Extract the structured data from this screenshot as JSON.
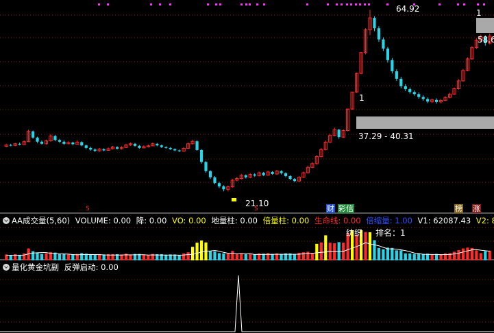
{
  "colors": {
    "background": "#000000",
    "grid": "#8b1a1a",
    "up": "#ff2a2a",
    "down": "#2ad4e8",
    "yellow": "#ffff00",
    "white": "#ffffff",
    "magenta": "#ff33ff",
    "gray_box": "#a9a9a9"
  },
  "price_panel": {
    "high_label": "64.92",
    "low_label": "21.10",
    "right_label": "58.6",
    "range_label": "37.29 - 40.31",
    "marker_1": "1",
    "marker_2": "1",
    "signal_tags": [
      {
        "text": "S"
      },
      {
        "text": "S"
      },
      {
        "text": "财"
      },
      {
        "text": "彩信"
      },
      {
        "text": "榜"
      },
      {
        "text": "涨"
      }
    ]
  },
  "volume_panel": {
    "indicator_name": "AA成交量(5,60)",
    "fields": [
      {
        "text": "VOLUME: 0.00",
        "color": "#ffffff"
      },
      {
        "text": "降: 0.00",
        "color": "#ffffff"
      },
      {
        "text": "VO: 0.00",
        "color": "#ffff00"
      },
      {
        "text": "地量柱: 0.00",
        "color": "#ffffff"
      },
      {
        "text": "倍量柱: 0.00",
        "color": "#ffff00"
      },
      {
        "text": "生命线: 0.00",
        "color": "#ff2a2a"
      },
      {
        "text": "倍缩量: 1.00",
        "color": "#2f4fff"
      },
      {
        "text": "V1: 62087.43",
        "color": "#ffffff"
      },
      {
        "text": "V2: 82337.84",
        "color": "#ffff00"
      }
    ],
    "note_1": "纺织",
    "note_2": "排名：1"
  },
  "indicator_panel": {
    "indicator_name": "量化黄金坑副",
    "fields": [
      {
        "text": "反弹启动: 0.00",
        "color": "#ffffff"
      }
    ]
  },
  "chart_data": {
    "type": "candlestick",
    "title": "",
    "price_high": 64.92,
    "price_low": 21.1,
    "candles": [
      [
        32.0,
        32.3,
        32.5,
        31.8
      ],
      [
        32.3,
        32.2,
        32.6,
        32.0
      ],
      [
        32.2,
        32.6,
        32.8,
        32.0
      ],
      [
        32.6,
        32.4,
        32.9,
        32.2
      ],
      [
        32.4,
        33.1,
        33.4,
        32.3
      ],
      [
        33.1,
        35.6,
        36.0,
        33.0
      ],
      [
        35.6,
        34.1,
        35.8,
        33.8
      ],
      [
        34.1,
        33.1,
        34.3,
        32.8
      ],
      [
        33.1,
        32.6,
        33.4,
        32.4
      ],
      [
        32.6,
        33.3,
        33.6,
        32.4
      ],
      [
        33.3,
        34.5,
        34.9,
        33.1
      ],
      [
        34.5,
        33.5,
        34.7,
        33.2
      ],
      [
        33.5,
        33.1,
        33.8,
        32.8
      ],
      [
        33.1,
        32.6,
        33.4,
        32.3
      ],
      [
        32.6,
        32.9,
        33.2,
        32.5
      ],
      [
        32.9,
        32.5,
        33.1,
        32.2
      ],
      [
        32.5,
        33.0,
        33.4,
        32.4
      ],
      [
        33.0,
        32.2,
        33.2,
        32.0
      ],
      [
        32.2,
        31.6,
        32.4,
        31.3
      ],
      [
        31.6,
        31.2,
        31.9,
        30.9
      ],
      [
        31.2,
        30.9,
        31.5,
        30.6
      ],
      [
        30.9,
        31.3,
        31.6,
        30.7
      ],
      [
        31.3,
        31.0,
        31.5,
        30.8
      ],
      [
        31.0,
        31.4,
        31.7,
        30.9
      ],
      [
        31.4,
        31.8,
        32.1,
        31.2
      ],
      [
        31.8,
        31.4,
        32.0,
        31.2
      ],
      [
        31.4,
        31.7,
        32.0,
        31.2
      ],
      [
        31.7,
        32.3,
        32.6,
        31.6
      ],
      [
        32.3,
        32.6,
        32.9,
        32.1
      ],
      [
        32.6,
        32.1,
        32.8,
        31.9
      ],
      [
        32.1,
        31.6,
        32.3,
        31.4
      ],
      [
        31.6,
        31.9,
        32.2,
        31.5
      ],
      [
        31.9,
        32.1,
        32.4,
        31.7
      ],
      [
        32.1,
        32.6,
        32.9,
        32.0
      ],
      [
        32.6,
        32.2,
        32.8,
        32.0
      ],
      [
        32.2,
        31.8,
        32.4,
        31.6
      ],
      [
        31.8,
        31.6,
        32.0,
        31.4
      ],
      [
        31.6,
        31.3,
        31.8,
        31.1
      ],
      [
        31.3,
        31.0,
        31.5,
        30.8
      ],
      [
        31.0,
        30.8,
        31.2,
        30.6
      ],
      [
        30.8,
        31.5,
        31.8,
        30.7
      ],
      [
        31.5,
        32.6,
        32.9,
        31.4
      ],
      [
        32.6,
        33.2,
        33.6,
        32.4
      ],
      [
        33.2,
        31.1,
        33.4,
        30.9
      ],
      [
        31.1,
        28.2,
        31.3,
        27.8
      ],
      [
        28.2,
        26.0,
        28.4,
        25.6
      ],
      [
        26.0,
        24.5,
        26.2,
        24.1
      ],
      [
        24.5,
        23.1,
        24.8,
        22.8
      ],
      [
        23.1,
        22.3,
        23.4,
        21.9
      ],
      [
        22.3,
        21.6,
        22.6,
        21.1
      ],
      [
        21.6,
        22.2,
        22.5,
        21.1
      ],
      [
        22.2,
        23.8,
        24.1,
        22.0
      ],
      [
        23.8,
        24.2,
        24.6,
        23.5
      ],
      [
        24.2,
        25.0,
        25.3,
        24.0
      ],
      [
        25.0,
        24.5,
        25.2,
        24.2
      ],
      [
        24.5,
        25.2,
        25.5,
        24.3
      ],
      [
        25.2,
        24.9,
        25.5,
        24.6
      ],
      [
        24.9,
        25.6,
        25.9,
        24.7
      ],
      [
        25.6,
        25.0,
        25.8,
        24.8
      ],
      [
        25.0,
        25.8,
        26.1,
        24.9
      ],
      [
        25.8,
        25.3,
        26.0,
        25.1
      ],
      [
        25.3,
        26.0,
        26.3,
        25.1
      ],
      [
        26.0,
        25.5,
        26.2,
        25.2
      ],
      [
        25.5,
        24.8,
        25.7,
        24.5
      ],
      [
        24.8,
        24.1,
        25.0,
        23.8
      ],
      [
        24.1,
        23.6,
        24.3,
        23.3
      ],
      [
        23.6,
        24.5,
        24.8,
        23.4
      ],
      [
        24.5,
        25.6,
        25.9,
        24.4
      ],
      [
        25.6,
        26.9,
        27.3,
        25.4
      ],
      [
        26.9,
        27.8,
        28.2,
        26.7
      ],
      [
        27.8,
        29.5,
        29.9,
        27.6
      ],
      [
        29.5,
        31.2,
        31.6,
        29.3
      ],
      [
        31.2,
        33.0,
        33.4,
        31.0
      ],
      [
        33.0,
        34.6,
        35.0,
        32.8
      ],
      [
        34.6,
        36.0,
        36.5,
        34.4
      ],
      [
        36.0,
        34.2,
        36.2,
        33.8
      ],
      [
        34.2,
        35.8,
        36.1,
        34.0
      ],
      [
        35.8,
        41.0,
        41.0,
        35.6
      ],
      [
        41.0,
        45.1,
        45.1,
        40.8
      ],
      [
        45.1,
        49.6,
        49.8,
        44.9
      ],
      [
        49.6,
        54.6,
        54.8,
        49.4
      ],
      [
        54.6,
        60.1,
        60.5,
        54.2
      ],
      [
        60.1,
        63.0,
        64.92,
        58.8
      ],
      [
        63.0,
        60.5,
        63.4,
        59.8
      ],
      [
        60.5,
        57.8,
        61.0,
        57.2
      ],
      [
        57.8,
        55.6,
        58.3,
        55.0
      ],
      [
        55.6,
        52.8,
        56.0,
        52.2
      ],
      [
        52.8,
        50.1,
        53.3,
        49.6
      ],
      [
        50.1,
        48.3,
        50.6,
        47.8
      ],
      [
        48.3,
        46.5,
        48.8,
        46.0
      ],
      [
        46.5,
        45.8,
        47.0,
        45.3
      ],
      [
        45.8,
        45.1,
        46.2,
        44.7
      ],
      [
        45.1,
        44.6,
        45.5,
        44.2
      ],
      [
        44.6,
        43.9,
        45.0,
        43.5
      ],
      [
        43.9,
        43.4,
        44.3,
        43.0
      ],
      [
        43.4,
        42.8,
        43.8,
        42.4
      ],
      [
        42.8,
        43.2,
        43.5,
        42.5
      ],
      [
        43.2,
        42.7,
        43.6,
        42.3
      ],
      [
        42.7,
        43.1,
        43.4,
        42.4
      ],
      [
        43.1,
        43.8,
        44.1,
        42.9
      ],
      [
        43.8,
        44.6,
        44.9,
        43.6
      ],
      [
        44.6,
        45.9,
        46.2,
        44.4
      ],
      [
        45.9,
        47.8,
        48.2,
        45.7
      ],
      [
        47.8,
        50.3,
        50.7,
        47.6
      ],
      [
        50.3,
        53.1,
        53.5,
        50.1
      ],
      [
        53.1,
        55.8,
        56.2,
        52.9
      ],
      [
        55.8,
        57.6,
        58.1,
        55.5
      ],
      [
        57.6,
        58.4,
        59.0,
        57.0
      ],
      [
        58.4,
        56.9,
        58.8,
        56.3
      ],
      [
        56.9,
        58.6,
        59.2,
        56.6
      ]
    ]
  }
}
